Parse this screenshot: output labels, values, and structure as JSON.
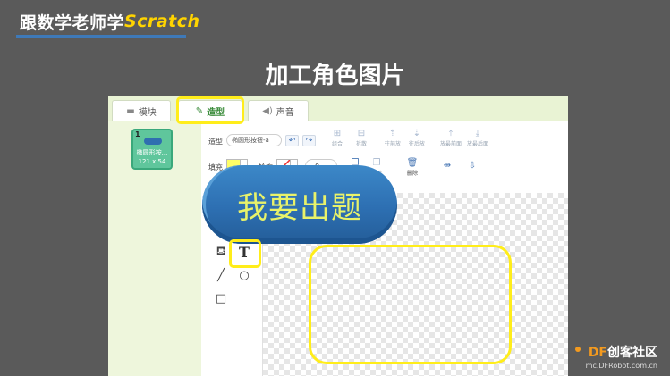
{
  "header": {
    "title_cn": "跟数学老师学",
    "title_en": "Scratch"
  },
  "heading": "加工角色图片",
  "tabs": [
    {
      "label": "模块",
      "icon": "blocks-icon"
    },
    {
      "label": "造型",
      "icon": "brush-icon"
    },
    {
      "label": "声音",
      "icon": "speaker-icon"
    }
  ],
  "sprite_thumb": {
    "index": "1",
    "name": "椭圆形按...",
    "size": "121 x 54"
  },
  "toolbar": {
    "costume_label": "造型",
    "costume_name": "椭圆形按钮-a",
    "undo": "↶",
    "redo": "↷",
    "row1_buttons": [
      "组合",
      "拆散",
      "往前放",
      "往后放",
      "放最前面",
      "放最后面"
    ],
    "fill_label": "填充",
    "outline_label": "轮廓",
    "fill_color": "#ffff66",
    "outline_width": "0",
    "row2_buttons": [
      "复制",
      "粘贴",
      "删除"
    ]
  },
  "canvas": {
    "text": "我要出题",
    "button_color": "#2f72b5",
    "text_color": "#e8f26a"
  },
  "watermark": {
    "brand_df": "DF",
    "brand_rest": "创客社区",
    "url": "mc.DFRobot.com.cn"
  },
  "colors": {
    "highlight": "#ffed1a",
    "page_bg": "#5a5a5a",
    "tab_bar": "#e9f3d4"
  }
}
